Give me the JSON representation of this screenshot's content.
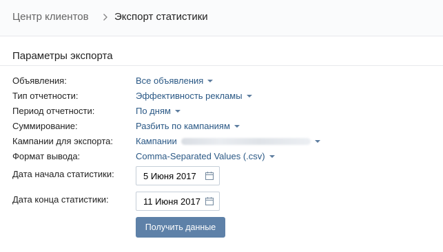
{
  "breadcrumb": {
    "parent": "Центр клиентов",
    "current": "Экспорт статистики"
  },
  "section": {
    "title": "Параметры экспорта"
  },
  "fields": [
    {
      "label": "Объявления:",
      "value": "Все объявления"
    },
    {
      "label": "Тип отчетности:",
      "value": "Эффективность рекламы"
    },
    {
      "label": "Период отчетности:",
      "value": "По дням"
    },
    {
      "label": "Суммирование:",
      "value": "Разбить по кампаниям"
    },
    {
      "label": "Кампании для экспорта:",
      "value": "Кампании"
    },
    {
      "label": "Формат вывода:",
      "value": "Comma-Separated Values (.csv)"
    }
  ],
  "dates": {
    "start_label": "Дата начала статистики:",
    "start_value": "5 Июня 2017",
    "end_label": "Дата конца статистики:",
    "end_value": "11 Июня 2017"
  },
  "submit_label": "Получить данные",
  "icons": {
    "breadcrumb_separator": "chevron-right-icon",
    "dropdown": "caret-down-icon",
    "calendar": "calendar-icon"
  },
  "colors": {
    "link": "#2a5885",
    "button_bg": "#5e81a8",
    "header_bg": "#fafbfc",
    "border": "#e7e8ec"
  }
}
